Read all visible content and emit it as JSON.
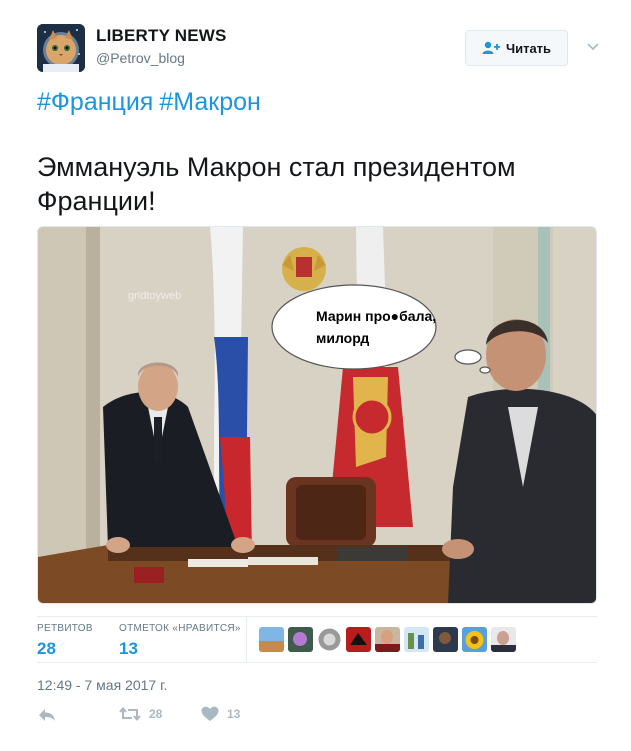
{
  "account": {
    "display_name": "LIBERTY NEWS",
    "username": "@Petrov_blog",
    "avatar_icon": "cat-astronaut-avatar"
  },
  "follow_button": {
    "label": "Читать"
  },
  "tweet": {
    "hashtags": [
      "#Франция",
      "#Макрон"
    ],
    "text_line1": "Эммануэль Макрон стал президентом",
    "text_line2": "Франции!",
    "image": {
      "watermark": "gridtoyweb",
      "bubble_line1": "Марин про●бала,",
      "bubble_line2": "милорд"
    }
  },
  "stats": {
    "retweets_label": "РЕТВИТОВ",
    "retweets_count": "28",
    "likes_label": "ОТМЕТОК «НРАВИТСЯ»",
    "likes_count": "13"
  },
  "timestamp": "12:49 - 7 мая 2017 г.",
  "actions": {
    "reply_icon": "reply-icon",
    "retweet_count": "28",
    "like_count": "13"
  },
  "colors": {
    "link_blue": "#1b95e0",
    "muted_gray": "#657786",
    "border": "#e6ecf0"
  }
}
